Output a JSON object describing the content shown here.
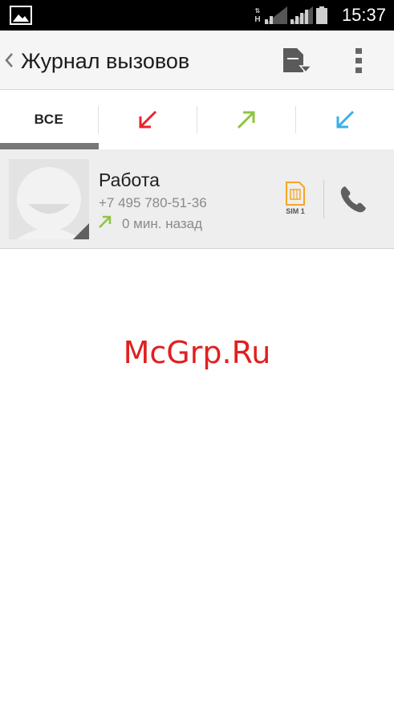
{
  "status_bar": {
    "network_type": "H",
    "time": "15:37",
    "icons": [
      "gallery-icon",
      "data-arrows-icon",
      "signal-icon",
      "signal-icon",
      "battery-icon"
    ]
  },
  "action_bar": {
    "title": "Журнал вызовов",
    "icons": [
      "back-chevron-icon",
      "sim-select-icon",
      "overflow-menu-icon"
    ]
  },
  "tabs": {
    "items": [
      {
        "label": "ВСЕ",
        "selected": true
      },
      {
        "icon": "missed-call-icon",
        "color": "#e8252b"
      },
      {
        "icon": "outgoing-call-icon",
        "color": "#8cc63f"
      },
      {
        "icon": "incoming-call-icon",
        "color": "#3aafe6"
      }
    ]
  },
  "call_log": [
    {
      "name": "Работа",
      "number": "+7 495 780-51-36",
      "type": "outgoing",
      "type_icon_color": "#8cc63f",
      "time": "0 мин. назад",
      "sim": "SIM 1",
      "sim_color": "#f5a623"
    }
  ],
  "watermark": "McGrp.Ru"
}
